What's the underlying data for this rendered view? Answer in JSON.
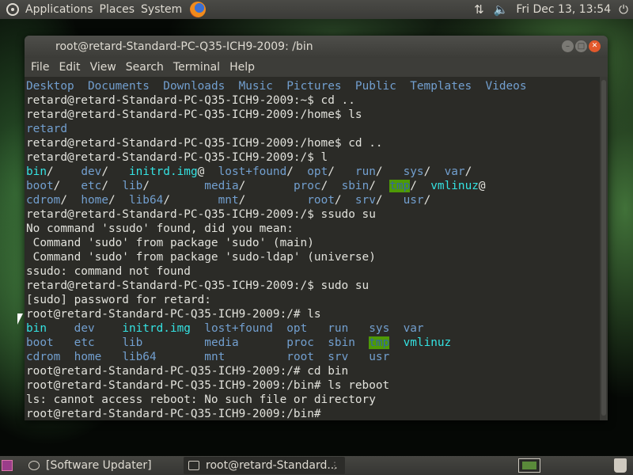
{
  "top_panel": {
    "menus": [
      "Applications",
      "Places",
      "System"
    ],
    "clock": "Fri Dec 13, 13:54",
    "icons": [
      "ubuntu-logo-icon",
      "firefox-icon",
      "network-updown-icon",
      "volume-icon",
      "power-icon"
    ]
  },
  "terminal": {
    "title": "root@retard-Standard-PC-Q35-ICH9-2009: /bin",
    "menus": [
      "File",
      "Edit",
      "View",
      "Search",
      "Terminal",
      "Help"
    ],
    "colors": {
      "directory": "#729fcf",
      "symlink": "#34e2e2",
      "sticky_dir_bg": "#4e9a06",
      "text": "#e2e2dc",
      "background": "#2b2b27"
    },
    "lines": [
      [
        {
          "t": "Desktop",
          "c": "dir"
        },
        {
          "t": "  "
        },
        {
          "t": "Documents",
          "c": "dir"
        },
        {
          "t": "  "
        },
        {
          "t": "Downloads",
          "c": "dir"
        },
        {
          "t": "  "
        },
        {
          "t": "Music",
          "c": "dir"
        },
        {
          "t": "  "
        },
        {
          "t": "Pictures",
          "c": "dir"
        },
        {
          "t": "  "
        },
        {
          "t": "Public",
          "c": "dir"
        },
        {
          "t": "  "
        },
        {
          "t": "Templates",
          "c": "dir"
        },
        {
          "t": "  "
        },
        {
          "t": "Videos",
          "c": "dir"
        }
      ],
      [
        {
          "t": "retard@retard-Standard-PC-Q35-ICH9-2009:~$ cd .."
        }
      ],
      [
        {
          "t": "retard@retard-Standard-PC-Q35-ICH9-2009:/home$ ls"
        }
      ],
      [
        {
          "t": "retard",
          "c": "dir"
        }
      ],
      [
        {
          "t": "retard@retard-Standard-PC-Q35-ICH9-2009:/home$ cd .."
        }
      ],
      [
        {
          "t": "retard@retard-Standard-PC-Q35-ICH9-2009:/$ l"
        }
      ],
      [
        {
          "t": "bin",
          "c": "link"
        },
        {
          "t": "/    "
        },
        {
          "t": "dev",
          "c": "dir"
        },
        {
          "t": "/   "
        },
        {
          "t": "initrd.img",
          "c": "link"
        },
        {
          "t": "@  "
        },
        {
          "t": "lost+found",
          "c": "dir"
        },
        {
          "t": "/  "
        },
        {
          "t": "opt",
          "c": "dir"
        },
        {
          "t": "/   "
        },
        {
          "t": "run",
          "c": "dir"
        },
        {
          "t": "/   "
        },
        {
          "t": "sys",
          "c": "dir"
        },
        {
          "t": "/  "
        },
        {
          "t": "var",
          "c": "dir"
        },
        {
          "t": "/"
        }
      ],
      [
        {
          "t": "boot",
          "c": "dir"
        },
        {
          "t": "/   "
        },
        {
          "t": "etc",
          "c": "dir"
        },
        {
          "t": "/  "
        },
        {
          "t": "lib",
          "c": "dir"
        },
        {
          "t": "/        "
        },
        {
          "t": "media",
          "c": "dir"
        },
        {
          "t": "/       "
        },
        {
          "t": "proc",
          "c": "dir"
        },
        {
          "t": "/  "
        },
        {
          "t": "sbin",
          "c": "dir"
        },
        {
          "t": "/  "
        },
        {
          "t": "tmp",
          "c": "hl"
        },
        {
          "t": "/  "
        },
        {
          "t": "vmlinuz",
          "c": "link"
        },
        {
          "t": "@"
        }
      ],
      [
        {
          "t": "cdrom",
          "c": "dir"
        },
        {
          "t": "/  "
        },
        {
          "t": "home",
          "c": "dir"
        },
        {
          "t": "/  "
        },
        {
          "t": "lib64",
          "c": "dir"
        },
        {
          "t": "/       "
        },
        {
          "t": "mnt",
          "c": "dir"
        },
        {
          "t": "/         "
        },
        {
          "t": "root",
          "c": "dir"
        },
        {
          "t": "/  "
        },
        {
          "t": "srv",
          "c": "dir"
        },
        {
          "t": "/   "
        },
        {
          "t": "usr",
          "c": "dir"
        },
        {
          "t": "/"
        }
      ],
      [
        {
          "t": "retard@retard-Standard-PC-Q35-ICH9-2009:/$ ssudo su"
        }
      ],
      [
        {
          "t": "No command 'ssudo' found, did you mean:"
        }
      ],
      [
        {
          "t": " Command 'sudo' from package 'sudo' (main)"
        }
      ],
      [
        {
          "t": " Command 'sudo' from package 'sudo-ldap' (universe)"
        }
      ],
      [
        {
          "t": "ssudo: command not found"
        }
      ],
      [
        {
          "t": "retard@retard-Standard-PC-Q35-ICH9-2009:/$ sudo su"
        }
      ],
      [
        {
          "t": "[sudo] password for retard:"
        }
      ],
      [
        {
          "t": "root@retard-Standard-PC-Q35-ICH9-2009:/# ls"
        }
      ],
      [
        {
          "t": "bin",
          "c": "link"
        },
        {
          "t": "    "
        },
        {
          "t": "dev",
          "c": "dir"
        },
        {
          "t": "    "
        },
        {
          "t": "initrd.img",
          "c": "link"
        },
        {
          "t": "  "
        },
        {
          "t": "lost+found",
          "c": "dir"
        },
        {
          "t": "  "
        },
        {
          "t": "opt",
          "c": "dir"
        },
        {
          "t": "   "
        },
        {
          "t": "run",
          "c": "dir"
        },
        {
          "t": "   "
        },
        {
          "t": "sys",
          "c": "dir"
        },
        {
          "t": "  "
        },
        {
          "t": "var",
          "c": "dir"
        }
      ],
      [
        {
          "t": "boot",
          "c": "dir"
        },
        {
          "t": "   "
        },
        {
          "t": "etc",
          "c": "dir"
        },
        {
          "t": "    "
        },
        {
          "t": "lib",
          "c": "dir"
        },
        {
          "t": "         "
        },
        {
          "t": "media",
          "c": "dir"
        },
        {
          "t": "       "
        },
        {
          "t": "proc",
          "c": "dir"
        },
        {
          "t": "  "
        },
        {
          "t": "sbin",
          "c": "dir"
        },
        {
          "t": "  "
        },
        {
          "t": "tmp",
          "c": "hl"
        },
        {
          "t": "  "
        },
        {
          "t": "vmlinuz",
          "c": "link"
        }
      ],
      [
        {
          "t": "cdrom",
          "c": "dir"
        },
        {
          "t": "  "
        },
        {
          "t": "home",
          "c": "dir"
        },
        {
          "t": "   "
        },
        {
          "t": "lib64",
          "c": "dir"
        },
        {
          "t": "       "
        },
        {
          "t": "mnt",
          "c": "dir"
        },
        {
          "t": "         "
        },
        {
          "t": "root",
          "c": "dir"
        },
        {
          "t": "  "
        },
        {
          "t": "srv",
          "c": "dir"
        },
        {
          "t": "   "
        },
        {
          "t": "usr",
          "c": "dir"
        }
      ],
      [
        {
          "t": "root@retard-Standard-PC-Q35-ICH9-2009:/# cd bin"
        }
      ],
      [
        {
          "t": "root@retard-Standard-PC-Q35-ICH9-2009:/bin# ls reboot"
        }
      ],
      [
        {
          "t": "ls: cannot access reboot: No such file or directory"
        }
      ],
      [
        {
          "t": "root@retard-Standard-PC-Q35-ICH9-2009:/bin#"
        }
      ]
    ]
  },
  "bottom_panel": {
    "tasks": [
      "[Software Updater]",
      "root@retard-Standard..."
    ]
  }
}
